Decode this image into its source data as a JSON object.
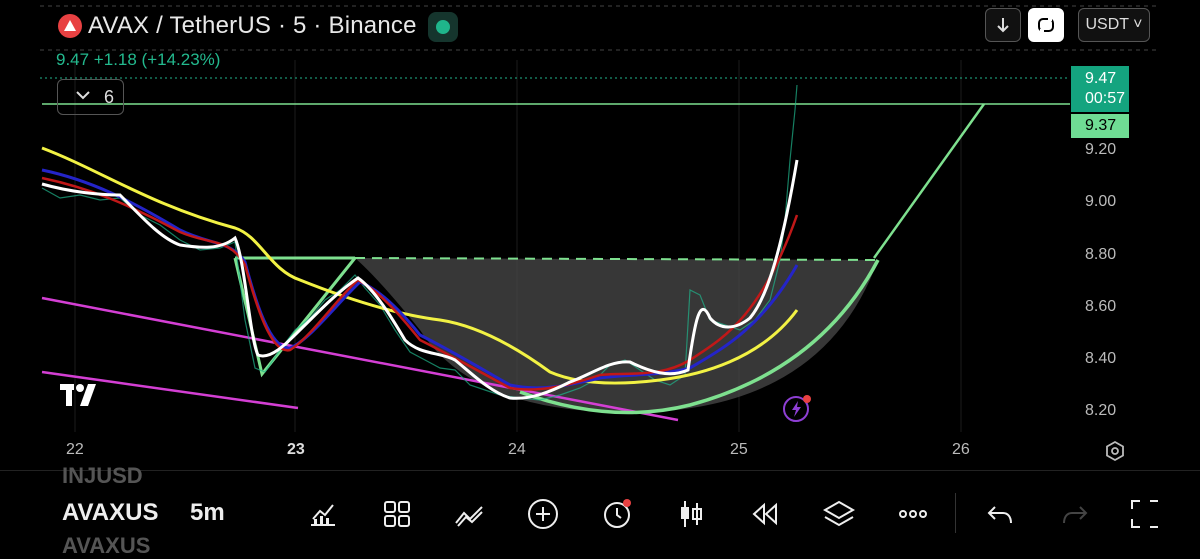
{
  "header": {
    "symbol_title": "AVAX / TetherUS · 5 · Binance",
    "change_text": "9.47  +1.18 (+14.23%)",
    "currency": "USDT ˅",
    "collapse_count": "6"
  },
  "price_axis": {
    "labels": [
      "9.20",
      "9.00",
      "8.80",
      "8.60",
      "8.40",
      "8.20"
    ],
    "current_price": "9.47",
    "countdown": "00:57",
    "level_price": "9.37"
  },
  "time_axis": {
    "labels": [
      "22",
      "23",
      "24",
      "25",
      "26"
    ]
  },
  "bottom_bar": {
    "symbol_above": "INJUSD",
    "symbol": "AVAXUS",
    "interval": "5m",
    "symbol_below": "AVAXUS"
  },
  "colors": {
    "background": "#000000",
    "up": "#1fb58b",
    "pattern_lines": "#7ee08f",
    "trendline": "#d43fd4",
    "ma_yellow": "#f2f244",
    "ma_blue": "#2424c8",
    "ma_red": "#c01818",
    "price_line": "#ffffff"
  },
  "icons": [
    "chart-indicators-icon",
    "layout-grid-icon",
    "drawing-tools-icon",
    "add-icon",
    "alert-icon",
    "candles-icon",
    "replay-icon",
    "layers-icon",
    "more-icon",
    "undo-icon",
    "redo-icon",
    "fullscreen-icon"
  ]
}
